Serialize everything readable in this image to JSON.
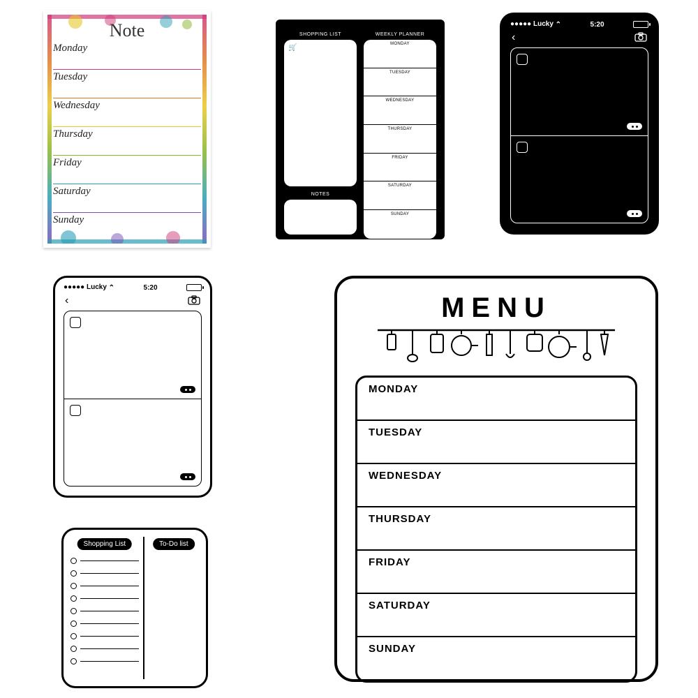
{
  "note": {
    "title": "Note",
    "days": [
      "Monday",
      "Tuesday",
      "Wednesday",
      "Thursday",
      "Friday",
      "Saturday",
      "Sunday"
    ],
    "row_colors": [
      "#d13a7a",
      "#e07a2a",
      "#e8c82a",
      "#86b52a",
      "#2a9fb5",
      "#7a4fb5",
      "#b52a7a"
    ]
  },
  "planner": {
    "shopping_label": "SHOPPING LIST",
    "weekly_label": "WEEKLY PLANNER",
    "notes_label": "NOTES",
    "cart_glyph": "🛒",
    "days": [
      "MONDAY",
      "TUESDAY",
      "WEDNESDAY",
      "THURSDAY",
      "FRIDAY",
      "SATURDAY",
      "SUNDAY"
    ]
  },
  "phone": {
    "carrier": "Lucky",
    "time": "5:20",
    "back_glyph": "‹",
    "camera_glyph": "⌷◉"
  },
  "todo": {
    "left_label": "Shopping List",
    "right_label": "To-Do list",
    "shopping_lines": 9
  },
  "menu": {
    "title": "MENU",
    "days": [
      "MONDAY",
      "TUESDAY",
      "WEDNESDAY",
      "THURSDAY",
      "FRIDAY",
      "SATURDAY",
      "SUNDAY"
    ]
  }
}
